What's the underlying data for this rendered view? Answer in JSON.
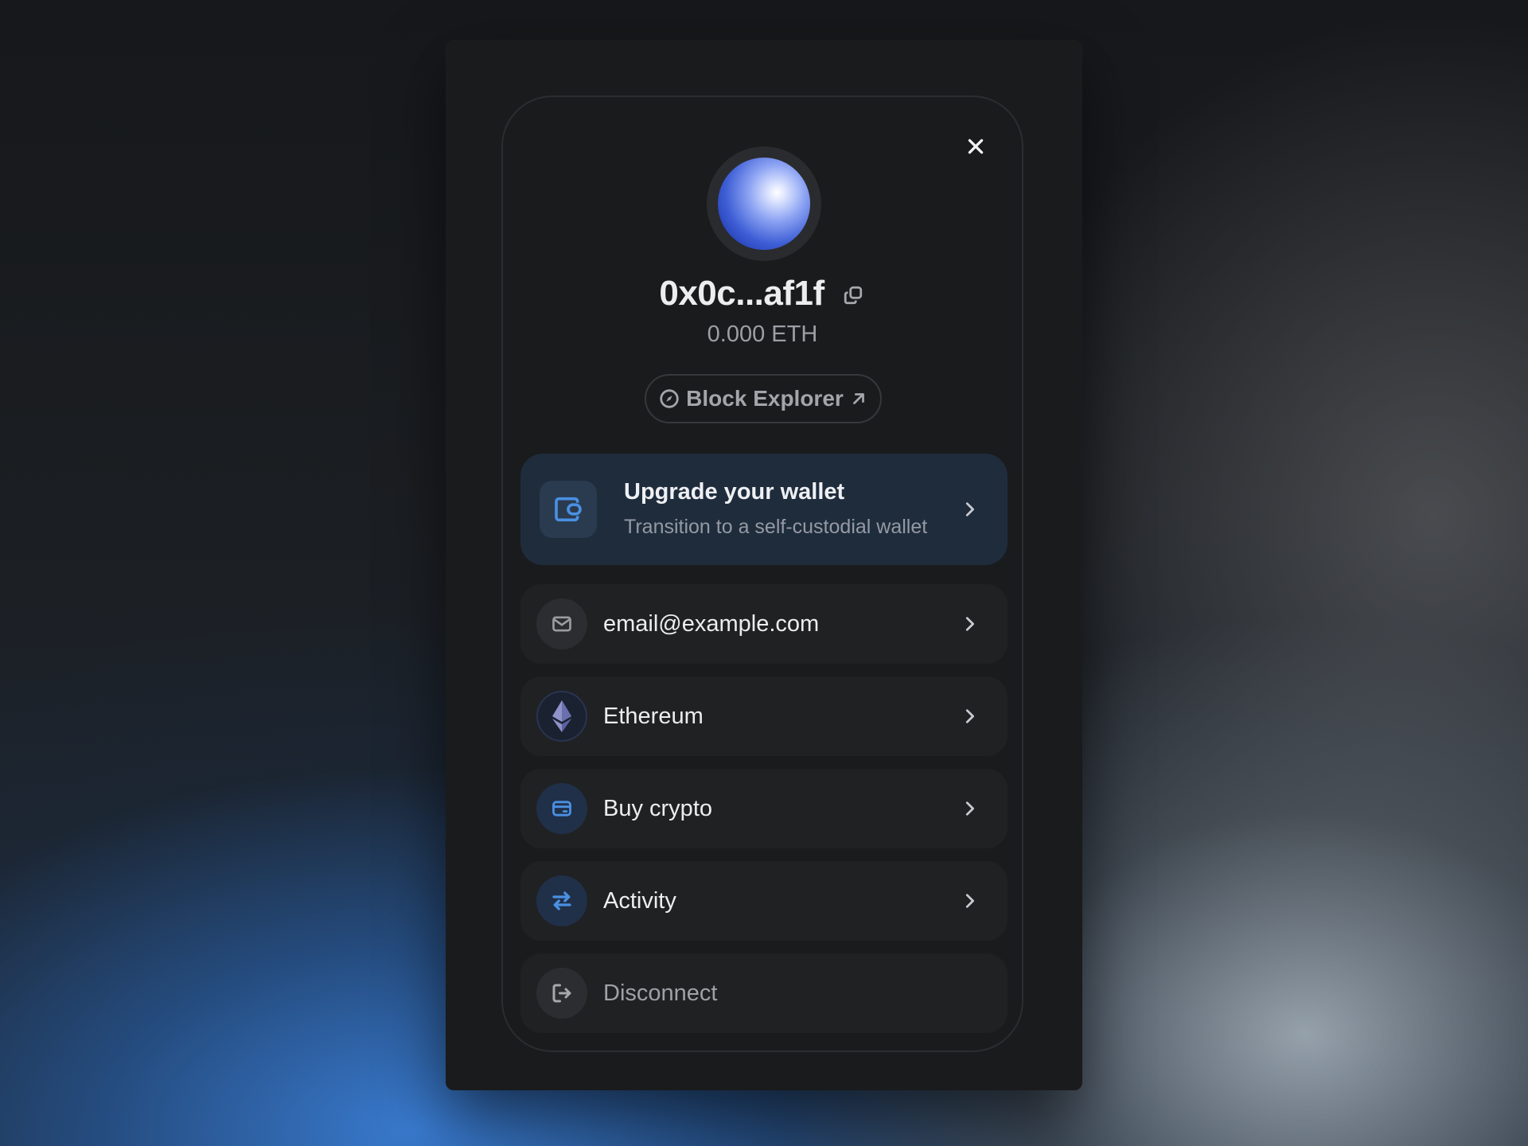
{
  "wallet": {
    "address": "0x0c...af1f",
    "balance": "0.000 ETH",
    "block_explorer_label": "Block Explorer"
  },
  "upgrade": {
    "title": "Upgrade your wallet",
    "subtitle": "Transition to a self-custodial wallet"
  },
  "menu": {
    "email": "email@example.com",
    "network": "Ethereum",
    "buy": "Buy crypto",
    "activity": "Activity",
    "disconnect": "Disconnect"
  },
  "icons": {
    "close": "close-icon",
    "copy": "copy-icon",
    "explorer": "compass-icon",
    "external": "arrow-up-right-icon",
    "wallet": "wallet-icon",
    "email": "mail-icon",
    "network": "ethereum-icon",
    "buy": "card-icon",
    "activity": "swap-arrows-icon",
    "disconnect": "logout-icon"
  },
  "colors": {
    "accent": "#4a90e2",
    "panel": "#1a1b1d",
    "upgrade_card": "#1f2c3c"
  }
}
